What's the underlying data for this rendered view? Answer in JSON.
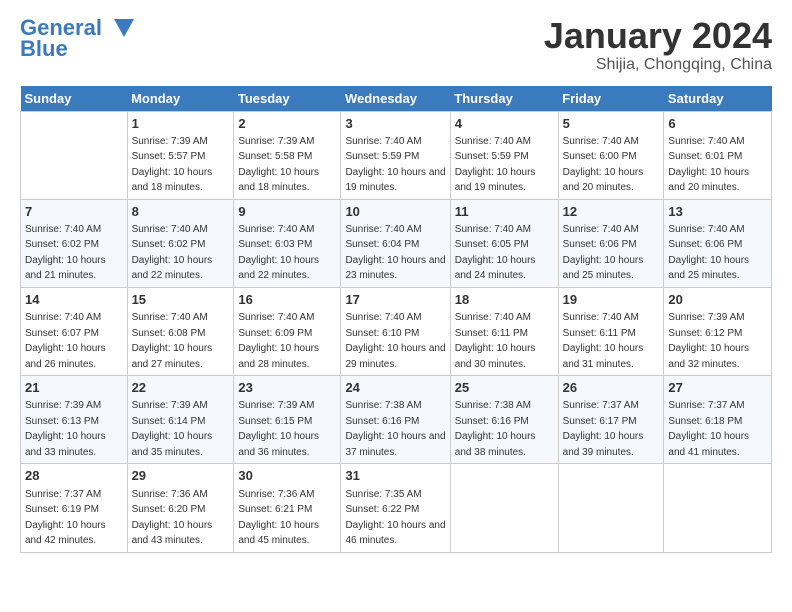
{
  "logo": {
    "line1": "General",
    "line2": "Blue"
  },
  "title": "January 2024",
  "subtitle": "Shijia, Chongqing, China",
  "headers": [
    "Sunday",
    "Monday",
    "Tuesday",
    "Wednesday",
    "Thursday",
    "Friday",
    "Saturday"
  ],
  "weeks": [
    [
      {
        "num": "",
        "sunrise": "",
        "sunset": "",
        "daylight": ""
      },
      {
        "num": "1",
        "sunrise": "Sunrise: 7:39 AM",
        "sunset": "Sunset: 5:57 PM",
        "daylight": "Daylight: 10 hours and 18 minutes."
      },
      {
        "num": "2",
        "sunrise": "Sunrise: 7:39 AM",
        "sunset": "Sunset: 5:58 PM",
        "daylight": "Daylight: 10 hours and 18 minutes."
      },
      {
        "num": "3",
        "sunrise": "Sunrise: 7:40 AM",
        "sunset": "Sunset: 5:59 PM",
        "daylight": "Daylight: 10 hours and 19 minutes."
      },
      {
        "num": "4",
        "sunrise": "Sunrise: 7:40 AM",
        "sunset": "Sunset: 5:59 PM",
        "daylight": "Daylight: 10 hours and 19 minutes."
      },
      {
        "num": "5",
        "sunrise": "Sunrise: 7:40 AM",
        "sunset": "Sunset: 6:00 PM",
        "daylight": "Daylight: 10 hours and 20 minutes."
      },
      {
        "num": "6",
        "sunrise": "Sunrise: 7:40 AM",
        "sunset": "Sunset: 6:01 PM",
        "daylight": "Daylight: 10 hours and 20 minutes."
      }
    ],
    [
      {
        "num": "7",
        "sunrise": "Sunrise: 7:40 AM",
        "sunset": "Sunset: 6:02 PM",
        "daylight": "Daylight: 10 hours and 21 minutes."
      },
      {
        "num": "8",
        "sunrise": "Sunrise: 7:40 AM",
        "sunset": "Sunset: 6:02 PM",
        "daylight": "Daylight: 10 hours and 22 minutes."
      },
      {
        "num": "9",
        "sunrise": "Sunrise: 7:40 AM",
        "sunset": "Sunset: 6:03 PM",
        "daylight": "Daylight: 10 hours and 22 minutes."
      },
      {
        "num": "10",
        "sunrise": "Sunrise: 7:40 AM",
        "sunset": "Sunset: 6:04 PM",
        "daylight": "Daylight: 10 hours and 23 minutes."
      },
      {
        "num": "11",
        "sunrise": "Sunrise: 7:40 AM",
        "sunset": "Sunset: 6:05 PM",
        "daylight": "Daylight: 10 hours and 24 minutes."
      },
      {
        "num": "12",
        "sunrise": "Sunrise: 7:40 AM",
        "sunset": "Sunset: 6:06 PM",
        "daylight": "Daylight: 10 hours and 25 minutes."
      },
      {
        "num": "13",
        "sunrise": "Sunrise: 7:40 AM",
        "sunset": "Sunset: 6:06 PM",
        "daylight": "Daylight: 10 hours and 25 minutes."
      }
    ],
    [
      {
        "num": "14",
        "sunrise": "Sunrise: 7:40 AM",
        "sunset": "Sunset: 6:07 PM",
        "daylight": "Daylight: 10 hours and 26 minutes."
      },
      {
        "num": "15",
        "sunrise": "Sunrise: 7:40 AM",
        "sunset": "Sunset: 6:08 PM",
        "daylight": "Daylight: 10 hours and 27 minutes."
      },
      {
        "num": "16",
        "sunrise": "Sunrise: 7:40 AM",
        "sunset": "Sunset: 6:09 PM",
        "daylight": "Daylight: 10 hours and 28 minutes."
      },
      {
        "num": "17",
        "sunrise": "Sunrise: 7:40 AM",
        "sunset": "Sunset: 6:10 PM",
        "daylight": "Daylight: 10 hours and 29 minutes."
      },
      {
        "num": "18",
        "sunrise": "Sunrise: 7:40 AM",
        "sunset": "Sunset: 6:11 PM",
        "daylight": "Daylight: 10 hours and 30 minutes."
      },
      {
        "num": "19",
        "sunrise": "Sunrise: 7:40 AM",
        "sunset": "Sunset: 6:11 PM",
        "daylight": "Daylight: 10 hours and 31 minutes."
      },
      {
        "num": "20",
        "sunrise": "Sunrise: 7:39 AM",
        "sunset": "Sunset: 6:12 PM",
        "daylight": "Daylight: 10 hours and 32 minutes."
      }
    ],
    [
      {
        "num": "21",
        "sunrise": "Sunrise: 7:39 AM",
        "sunset": "Sunset: 6:13 PM",
        "daylight": "Daylight: 10 hours and 33 minutes."
      },
      {
        "num": "22",
        "sunrise": "Sunrise: 7:39 AM",
        "sunset": "Sunset: 6:14 PM",
        "daylight": "Daylight: 10 hours and 35 minutes."
      },
      {
        "num": "23",
        "sunrise": "Sunrise: 7:39 AM",
        "sunset": "Sunset: 6:15 PM",
        "daylight": "Daylight: 10 hours and 36 minutes."
      },
      {
        "num": "24",
        "sunrise": "Sunrise: 7:38 AM",
        "sunset": "Sunset: 6:16 PM",
        "daylight": "Daylight: 10 hours and 37 minutes."
      },
      {
        "num": "25",
        "sunrise": "Sunrise: 7:38 AM",
        "sunset": "Sunset: 6:16 PM",
        "daylight": "Daylight: 10 hours and 38 minutes."
      },
      {
        "num": "26",
        "sunrise": "Sunrise: 7:37 AM",
        "sunset": "Sunset: 6:17 PM",
        "daylight": "Daylight: 10 hours and 39 minutes."
      },
      {
        "num": "27",
        "sunrise": "Sunrise: 7:37 AM",
        "sunset": "Sunset: 6:18 PM",
        "daylight": "Daylight: 10 hours and 41 minutes."
      }
    ],
    [
      {
        "num": "28",
        "sunrise": "Sunrise: 7:37 AM",
        "sunset": "Sunset: 6:19 PM",
        "daylight": "Daylight: 10 hours and 42 minutes."
      },
      {
        "num": "29",
        "sunrise": "Sunrise: 7:36 AM",
        "sunset": "Sunset: 6:20 PM",
        "daylight": "Daylight: 10 hours and 43 minutes."
      },
      {
        "num": "30",
        "sunrise": "Sunrise: 7:36 AM",
        "sunset": "Sunset: 6:21 PM",
        "daylight": "Daylight: 10 hours and 45 minutes."
      },
      {
        "num": "31",
        "sunrise": "Sunrise: 7:35 AM",
        "sunset": "Sunset: 6:22 PM",
        "daylight": "Daylight: 10 hours and 46 minutes."
      },
      {
        "num": "",
        "sunrise": "",
        "sunset": "",
        "daylight": ""
      },
      {
        "num": "",
        "sunrise": "",
        "sunset": "",
        "daylight": ""
      },
      {
        "num": "",
        "sunrise": "",
        "sunset": "",
        "daylight": ""
      }
    ]
  ]
}
